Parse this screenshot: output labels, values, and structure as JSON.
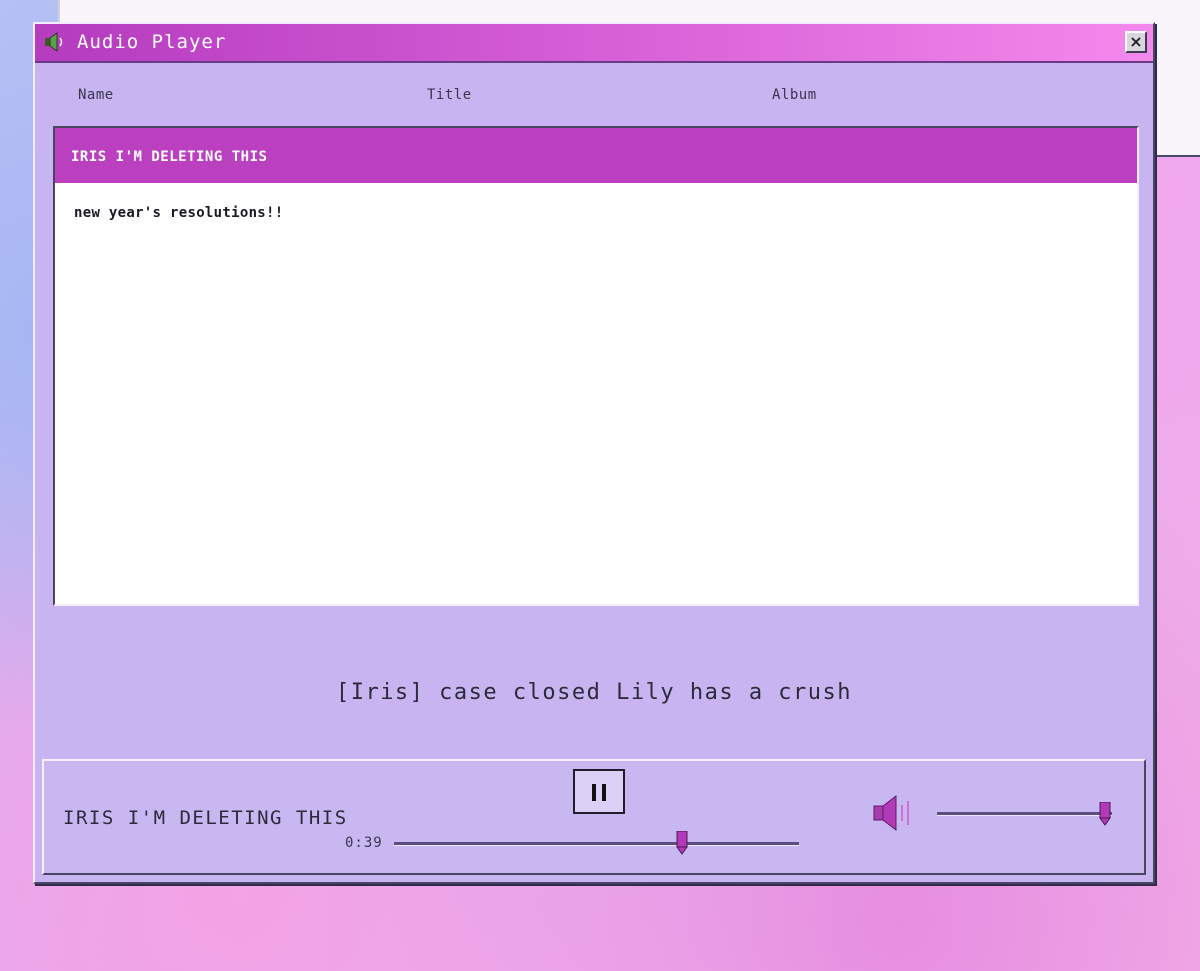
{
  "window": {
    "title": "Audio Player",
    "title_icon": "speaker-icon",
    "close_label": "×"
  },
  "columns": {
    "name": "Name",
    "title": "Title",
    "album": "Album"
  },
  "playlist": [
    {
      "name": "IRIS I'M DELETING THIS",
      "selected": true
    },
    {
      "name": "new year's resolutions!!",
      "selected": false
    }
  ],
  "lyric": "[Iris] case closed Lily has a crush",
  "player": {
    "now_playing": "IRIS I'M DELETING THIS",
    "time": "0:39",
    "progress": 0.71,
    "volume": 0.96,
    "pause_icon": "pause-icon",
    "volume_icon": "speaker-icon"
  },
  "colors": {
    "accent": "#bb40c0",
    "window_bg": "#c8b4f0",
    "titlebar_end": "#f489ec"
  }
}
